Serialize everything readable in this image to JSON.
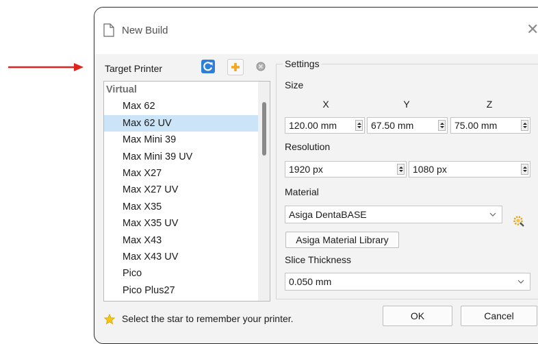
{
  "window": {
    "title": "New Build",
    "close_glyph": "✕"
  },
  "annotation": {
    "arrow_color": "#e0231c"
  },
  "target_printer": {
    "label": "Target Printer",
    "buttons": [
      {
        "icon": "refresh-icon",
        "color": "#2f7ed8"
      },
      {
        "icon": "add-printer-icon",
        "color": "#f2a81d"
      },
      {
        "icon": "remove-printer-icon",
        "color": "#a0a0a0"
      }
    ],
    "list": [
      {
        "label": "Virtual",
        "group": true
      },
      {
        "label": "Max 62"
      },
      {
        "label": "Max 62 UV",
        "selected": true
      },
      {
        "label": "Max Mini 39"
      },
      {
        "label": "Max Mini 39 UV"
      },
      {
        "label": "Max X27"
      },
      {
        "label": "Max X27 UV"
      },
      {
        "label": "Max X35"
      },
      {
        "label": "Max X35 UV"
      },
      {
        "label": "Max X43"
      },
      {
        "label": "Max X43 UV"
      },
      {
        "label": "Pico"
      },
      {
        "label": "Pico Plus27"
      }
    ]
  },
  "settings": {
    "legend": "Settings",
    "size": {
      "label": "Size",
      "x_label": "X",
      "y_label": "Y",
      "z_label": "Z",
      "x_value": "120.00 mm",
      "y_value": "67.50 mm",
      "z_value": "75.00 mm"
    },
    "resolution": {
      "label": "Resolution",
      "width": "1920 px",
      "height": "1080 px"
    },
    "material": {
      "label": "Material",
      "value": "Asiga DentaBASE",
      "library_button": "Asiga Material Library"
    },
    "slice_thickness": {
      "label": "Slice Thickness",
      "value": "0.050 mm"
    }
  },
  "footer": {
    "hint": "Select the star to remember your printer.",
    "ok": "OK",
    "cancel": "Cancel",
    "star_color": "#f5c518"
  }
}
